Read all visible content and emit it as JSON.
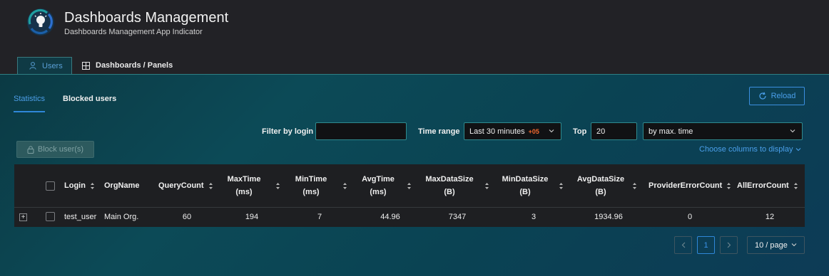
{
  "app": {
    "title": "Dashboards Management",
    "subtitle": "Dashboards Management App Indicator"
  },
  "top_tabs": [
    {
      "label": "Users",
      "icon": "user-icon",
      "active": true
    },
    {
      "label": "Dashboards / Panels",
      "icon": "grid-icon",
      "active": false
    }
  ],
  "sub_tabs": [
    {
      "label": "Statistics",
      "active": true
    },
    {
      "label": "Blocked users",
      "active": false
    }
  ],
  "reload_label": "Reload",
  "filters": {
    "filter_label": "Filter by login",
    "filter_value": "",
    "time_range_label": "Time range",
    "time_range_value": "Last 30 minutes",
    "time_range_offset": "+05",
    "top_label": "Top",
    "top_value": "20",
    "order_value": "by max. time"
  },
  "block_button_label": "Block user(s)",
  "choose_columns_label": "Choose columns to display",
  "table": {
    "headers": {
      "login": "Login",
      "org": "OrgName",
      "query_count": "QueryCount",
      "max_time_1": "MaxTime",
      "max_time_2": "(ms)",
      "min_time_1": "MinTime",
      "min_time_2": "(ms)",
      "avg_time_1": "AvgTime",
      "avg_time_2": "(ms)",
      "max_size_1": "MaxDataSize",
      "max_size_2": "(B)",
      "min_size_1": "MinDataSize",
      "min_size_2": "(B)",
      "avg_size_1": "AvgDataSize",
      "avg_size_2": "(B)",
      "provider_errors": "ProviderErrorCount",
      "all_errors": "AllErrorCount"
    },
    "rows": [
      {
        "login": "test_user",
        "org": "Main Org.",
        "query_count": "60",
        "max_time": "194",
        "min_time": "7",
        "avg_time": "44.96",
        "max_size": "7347",
        "min_size": "3",
        "avg_size": "1934.96",
        "provider_errors": "0",
        "all_errors": "12"
      }
    ]
  },
  "pagination": {
    "current_page": "1",
    "page_size": "10 / page"
  },
  "colors": {
    "accent": "#2f87d8",
    "offset_accent": "#f2682e"
  }
}
